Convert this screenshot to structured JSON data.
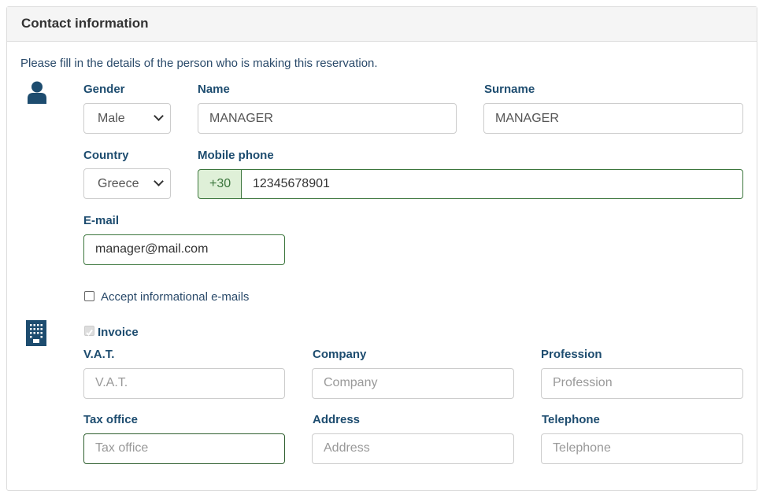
{
  "title": "Contact information",
  "description": "Please fill in the details of the person who is making this reservation.",
  "icons": {
    "person": "user-icon",
    "company": "building-icon"
  },
  "colors": {
    "label": "#1d4c6f",
    "valid": "#3c763d",
    "addon_bg": "#dff0d8"
  },
  "personal": {
    "gender": {
      "label": "Gender",
      "value": "Male"
    },
    "name": {
      "label": "Name",
      "value": "MANAGER"
    },
    "surname": {
      "label": "Surname",
      "value": "MANAGER"
    },
    "country": {
      "label": "Country",
      "value": "Greece"
    },
    "mobile": {
      "label": "Mobile phone",
      "prefix": "+30",
      "value": "12345678901"
    },
    "email": {
      "label": "E-mail",
      "value": "manager@mail.com"
    },
    "accept": {
      "label": "Accept informational e-mails",
      "checked": false
    }
  },
  "invoice": {
    "label": "Invoice",
    "checked": true,
    "vat": {
      "label": "V.A.T.",
      "placeholder": "V.A.T."
    },
    "company": {
      "label": "Company",
      "placeholder": "Company"
    },
    "profession": {
      "label": "Profession",
      "placeholder": "Profession"
    },
    "tax_office": {
      "label": "Tax office",
      "placeholder": "Tax office"
    },
    "address": {
      "label": "Address",
      "placeholder": "Address"
    },
    "telephone": {
      "label": "Telephone",
      "placeholder": "Telephone"
    }
  }
}
